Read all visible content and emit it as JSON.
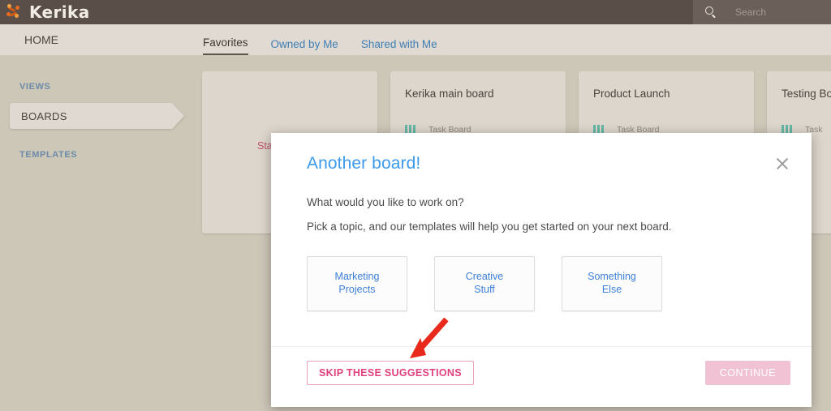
{
  "topbar": {
    "brand": "Kerika",
    "logo_icon": "kerika-logo-icon",
    "search_icon": "search-icon",
    "search_placeholder": "Search",
    "search_value": ""
  },
  "navbar": {
    "home_label": "HOME",
    "tabs": [
      {
        "label": "Favorites",
        "active": true
      },
      {
        "label": "Owned by Me",
        "active": false
      },
      {
        "label": "Shared with Me",
        "active": false
      }
    ]
  },
  "sidebar": {
    "views_label": "VIEWS",
    "boards_label": "BOARDS",
    "templates_label": "TEMPLATES"
  },
  "boards": {
    "new_card": {
      "partial_label": "Sta"
    },
    "cards": [
      {
        "title": "Kerika main board",
        "type_label": "Task Board",
        "type_icon": "board-columns-icon"
      },
      {
        "title": "Product Launch",
        "type_label": "Task Board",
        "type_icon": "board-columns-icon"
      },
      {
        "title": "Testing Bo",
        "type_label": "Task",
        "type_icon": "board-columns-icon"
      }
    ]
  },
  "modal": {
    "title": "Another board!",
    "close_icon": "close-icon",
    "question": "What would you like to work on?",
    "subtitle": "Pick a topic, and our templates will help you get started on your next board.",
    "topics": [
      {
        "line1": "Marketing",
        "line2": "Projects"
      },
      {
        "line1": "Creative",
        "line2": "Stuff"
      },
      {
        "line1": "Something",
        "line2": "Else"
      }
    ],
    "skip_label": "SKIP THESE SUGGESTIONS",
    "continue_label": "CONTINUE"
  },
  "annotation": {
    "arrow_icon": "red-arrow-pointing-down-left",
    "color": "#e8291c"
  },
  "colors": {
    "topbar_bg": "#594f48",
    "navbar_bg": "#e0dad3",
    "page_bg": "#cdc7b8",
    "card_bg": "#ddd6cc",
    "accent_blue": "#3c9aeb",
    "accent_pink": "#e0407d",
    "board_type_teal": "#63b8a4"
  }
}
